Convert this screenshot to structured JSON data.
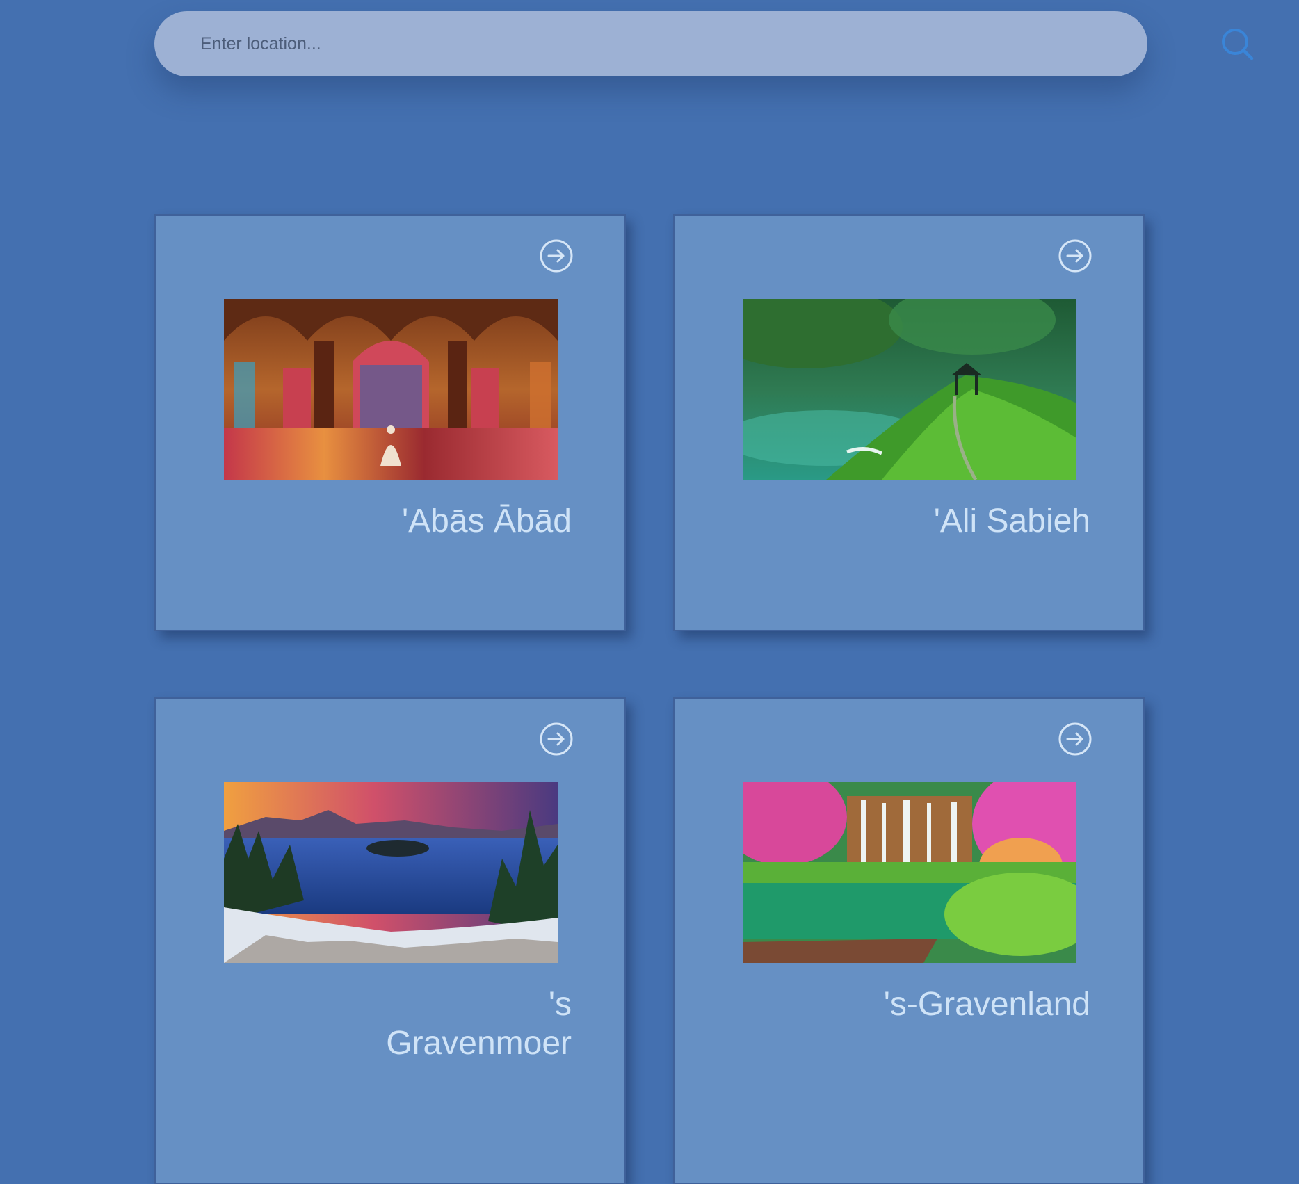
{
  "search": {
    "placeholder": "Enter location...",
    "value": "",
    "icon": "search-icon"
  },
  "colors": {
    "background": "#4470b0",
    "search_bar": "#9db1d4",
    "card": "#6690c4",
    "title_text": "#cfe3f7",
    "search_icon": "#3a85d8"
  },
  "cards": [
    {
      "title": "'Abās Ābād",
      "icon": "arrow-right-circle-icon",
      "image": "stained-glass-mosque-interior"
    },
    {
      "title": "'Ali Sabieh",
      "icon": "arrow-right-circle-icon",
      "image": "misty-green-forest-pavilion"
    },
    {
      "title": "'s Gravenmoer",
      "icon": "arrow-right-circle-icon",
      "image": "sunset-mountain-lake"
    },
    {
      "title": "'s-Gravenland",
      "icon": "arrow-right-circle-icon",
      "image": "waterfall-pink-garden"
    }
  ]
}
